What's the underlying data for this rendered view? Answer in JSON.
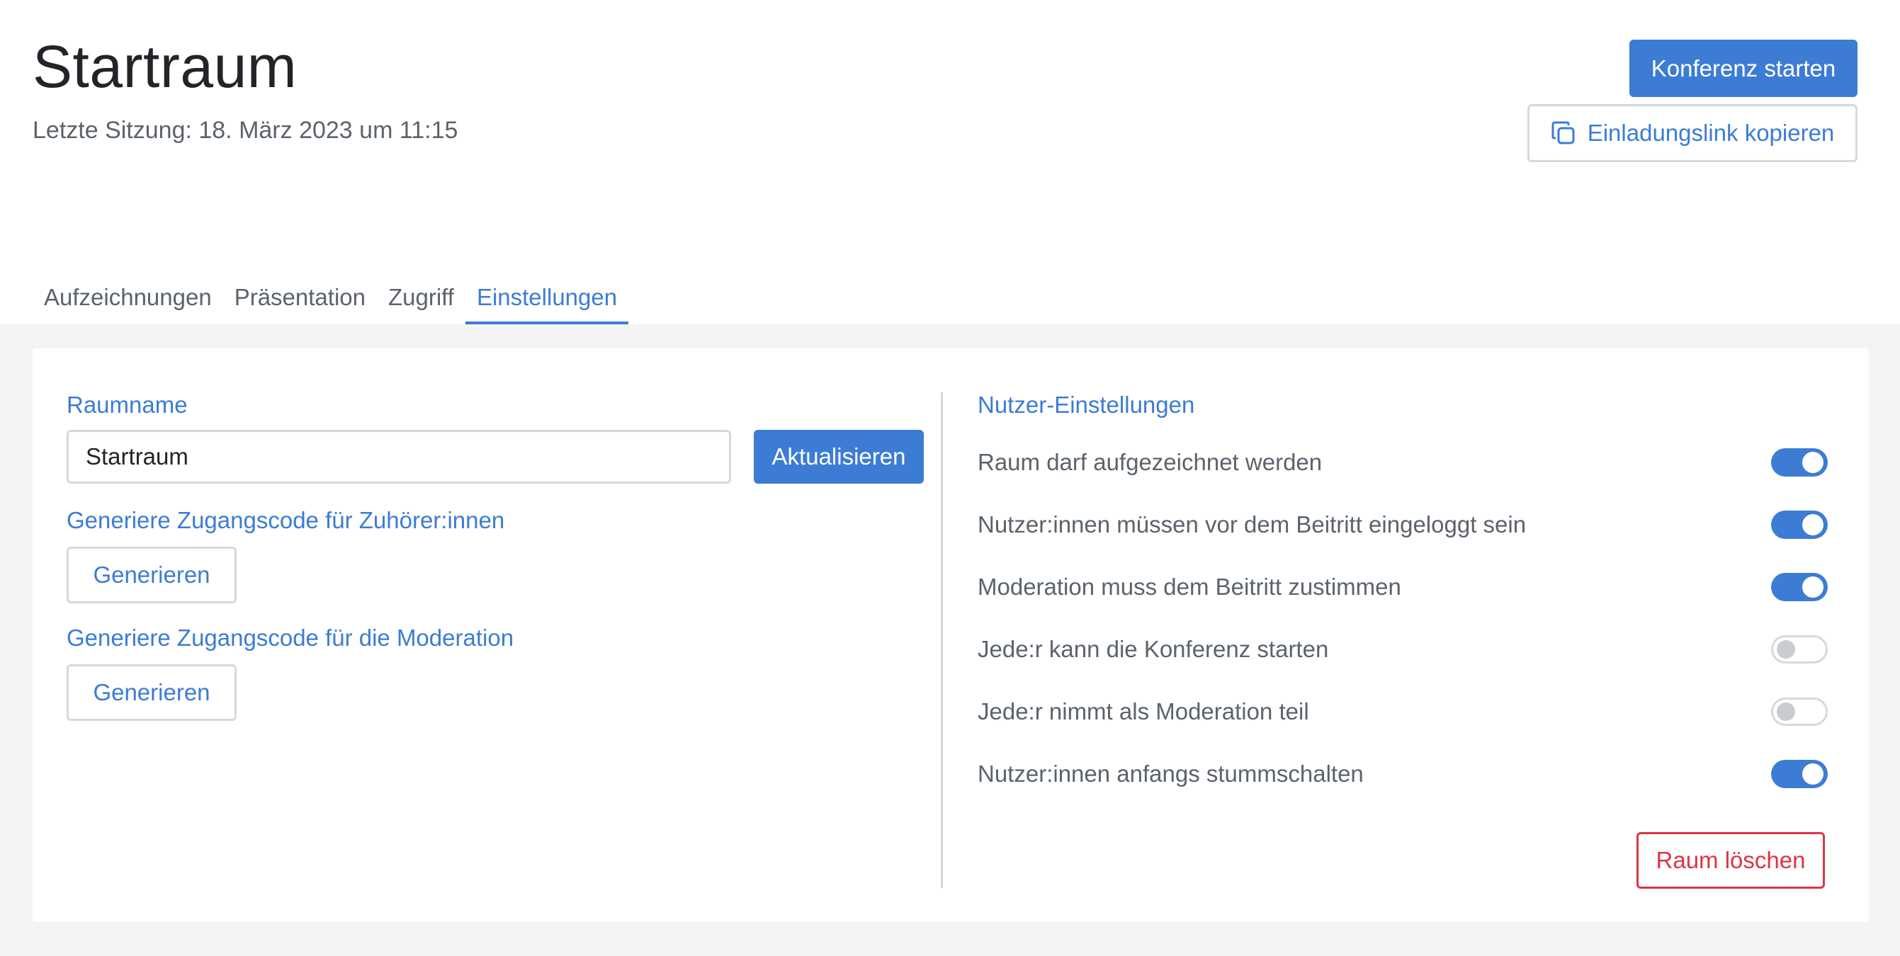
{
  "header": {
    "title": "Startraum",
    "last_session": "Letzte Sitzung: 18. März 2023 um 11:15",
    "start_button": "Konferenz starten",
    "invite_button": "Einladungslink kopieren"
  },
  "tabs": [
    {
      "label": "Aufzeichnungen",
      "active": false
    },
    {
      "label": "Präsentation",
      "active": false
    },
    {
      "label": "Zugriff",
      "active": false
    },
    {
      "label": "Einstellungen",
      "active": true
    }
  ],
  "room_settings": {
    "room_name_label": "Raumname",
    "room_name_value": "Startraum",
    "update_button": "Aktualisieren",
    "listener_code_label": "Generiere Zugangscode für Zuhörer:innen",
    "listener_generate_button": "Generieren",
    "moderator_code_label": "Generiere Zugangscode für die Moderation",
    "moderator_generate_button": "Generieren"
  },
  "user_settings": {
    "heading": "Nutzer-Einstellungen",
    "items": [
      {
        "label": "Raum darf aufgezeichnet werden",
        "enabled": true
      },
      {
        "label": "Nutzer:innen müssen vor dem Beitritt eingeloggt sein",
        "enabled": true
      },
      {
        "label": "Moderation muss dem Beitritt zustimmen",
        "enabled": true
      },
      {
        "label": "Jede:r kann die Konferenz starten",
        "enabled": false
      },
      {
        "label": "Jede:r nimmt als Moderation teil",
        "enabled": false
      },
      {
        "label": "Nutzer:innen anfangs stummschalten",
        "enabled": true
      }
    ],
    "delete_button": "Raum löschen"
  },
  "colors": {
    "accent": "#3c7cd4",
    "danger": "#dc3545",
    "muted_text": "#5b636b",
    "background": "#f4f4f4"
  },
  "icons": {
    "invite": "copy-icon"
  }
}
